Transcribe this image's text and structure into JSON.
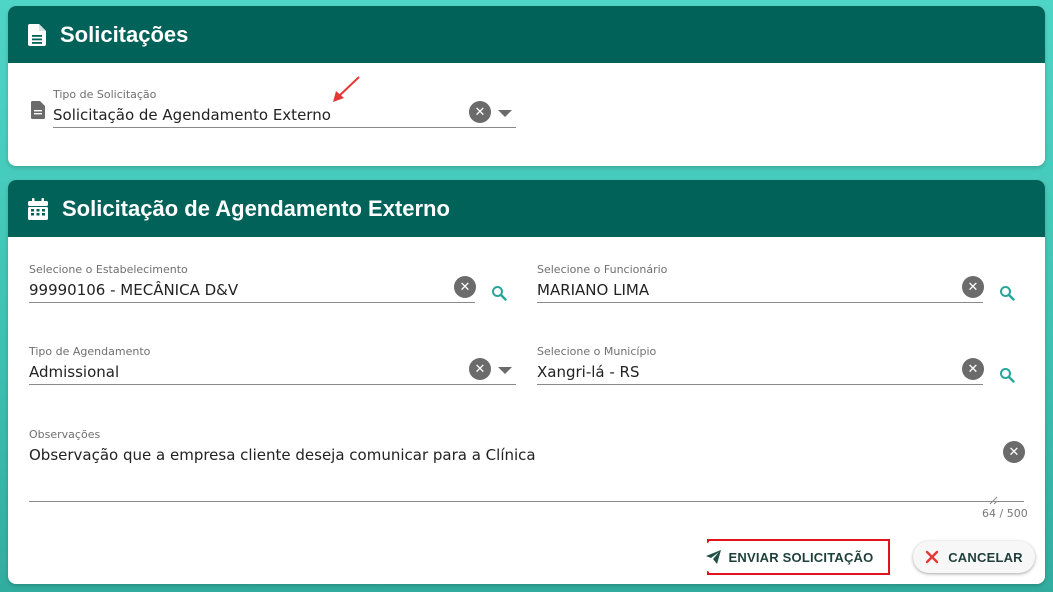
{
  "card1": {
    "title": "Solicitações",
    "tipo_label": "Tipo de Solicitação",
    "tipo_value": "Solicitação de Agendamento Externo"
  },
  "card2": {
    "title": "Solicitação de Agendamento Externo",
    "estabelecimento": {
      "label": "Selecione o Estabelecimento",
      "value": "99990106 - MECÂNICA D&V"
    },
    "funcionario": {
      "label": "Selecione o Funcionário",
      "value": "MARIANO LIMA"
    },
    "tipo_agendamento": {
      "label": "Tipo de Agendamento",
      "value": "Admissional"
    },
    "municipio": {
      "label": "Selecione o Município",
      "value": "Xangri-lá - RS"
    },
    "observacoes": {
      "label": "Observações",
      "value": "Observação que a empresa cliente deseja comunicar para a Clínica",
      "counter": "64 / 500"
    }
  },
  "actions": {
    "send_label": "ENVIAR SOLICITAÇÃO",
    "cancel_label": "CANCELAR"
  },
  "colors": {
    "header": "#006258",
    "search_icon": "#27a79a",
    "highlight": "#e0141e",
    "cancel_icon": "#e53935"
  },
  "icons": [
    "document-icon",
    "calendar-icon",
    "clear-icon",
    "dropdown-caret-icon",
    "search-icon",
    "send-icon",
    "close-icon",
    "annotation-arrow-icon"
  ]
}
